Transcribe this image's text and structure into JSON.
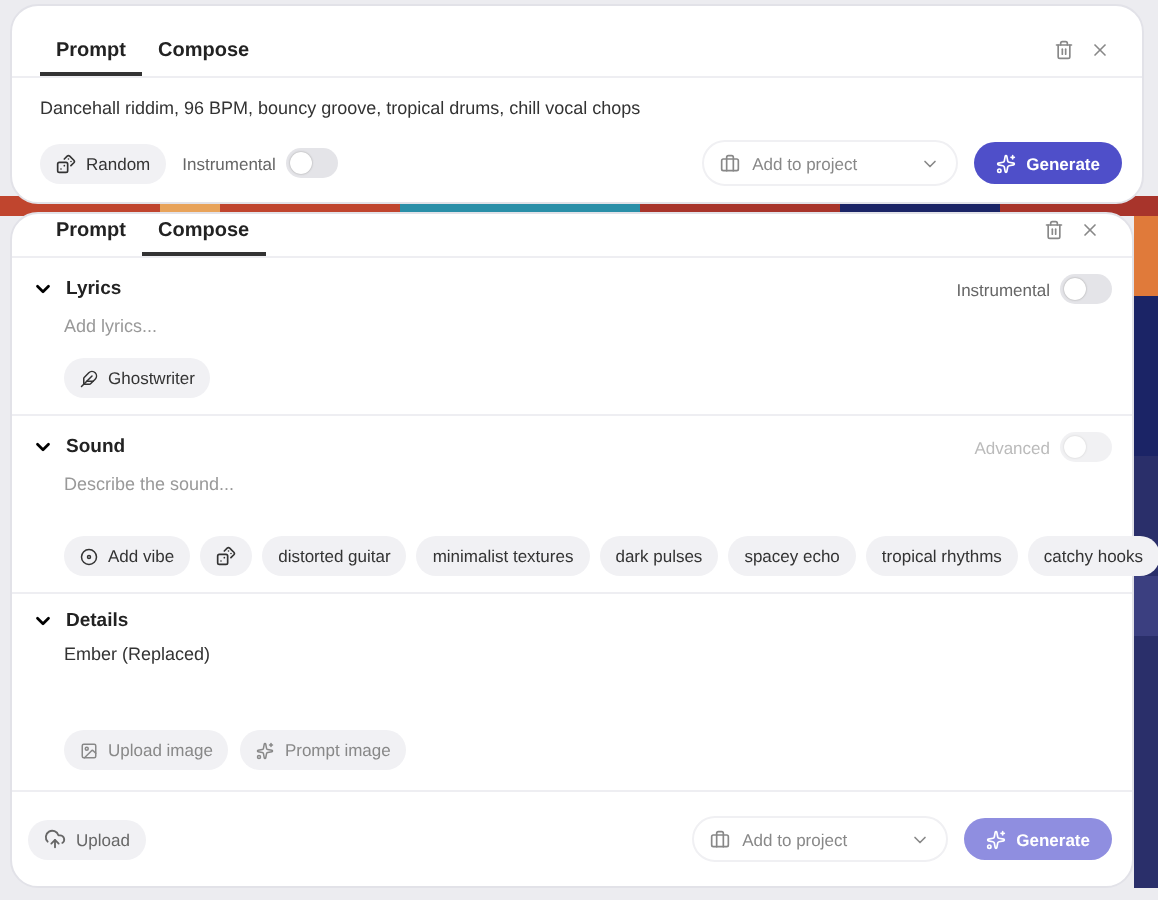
{
  "prompt_panel": {
    "tabs": [
      {
        "label": "Prompt",
        "selected": true
      },
      {
        "label": "Compose",
        "selected": false
      }
    ],
    "prompt_text": "Dancehall riddim, 96 BPM, bouncy groove, tropical drums, chill vocal chops",
    "random_button": "Random",
    "instrumental": {
      "label": "Instrumental",
      "on": false
    },
    "project_select": {
      "placeholder": "Add to project"
    },
    "generate_button": {
      "label": "Generate",
      "disabled": false
    }
  },
  "compose_panel": {
    "tabs": [
      {
        "label": "Prompt",
        "selected": false
      },
      {
        "label": "Compose",
        "selected": true
      }
    ],
    "sections": [
      {
        "kind": "lyrics",
        "title": "Lyrics",
        "expanded": true,
        "toggle": {
          "label": "Instrumental",
          "on": false,
          "disabled": false
        },
        "placeholder": "Add lyrics...",
        "buttons": [
          "Ghostwriter"
        ]
      },
      {
        "kind": "sound",
        "title": "Sound",
        "expanded": true,
        "toggle": {
          "label": "Advanced",
          "on": false,
          "disabled": true
        },
        "placeholder": "Describe the sound...",
        "add_vibe": "Add vibe",
        "tags": [
          "distorted guitar",
          "minimalist textures",
          "dark pulses",
          "spacey echo",
          "tropical rhythms",
          "catchy hooks"
        ]
      },
      {
        "kind": "details",
        "title": "Details",
        "expanded": true,
        "value": "Ember (Replaced)",
        "buttons": [
          "Upload image",
          "Prompt image"
        ]
      }
    ],
    "upload_button": "Upload",
    "project_select": {
      "placeholder": "Add to project"
    },
    "generate_button": {
      "label": "Generate",
      "disabled": true
    }
  }
}
